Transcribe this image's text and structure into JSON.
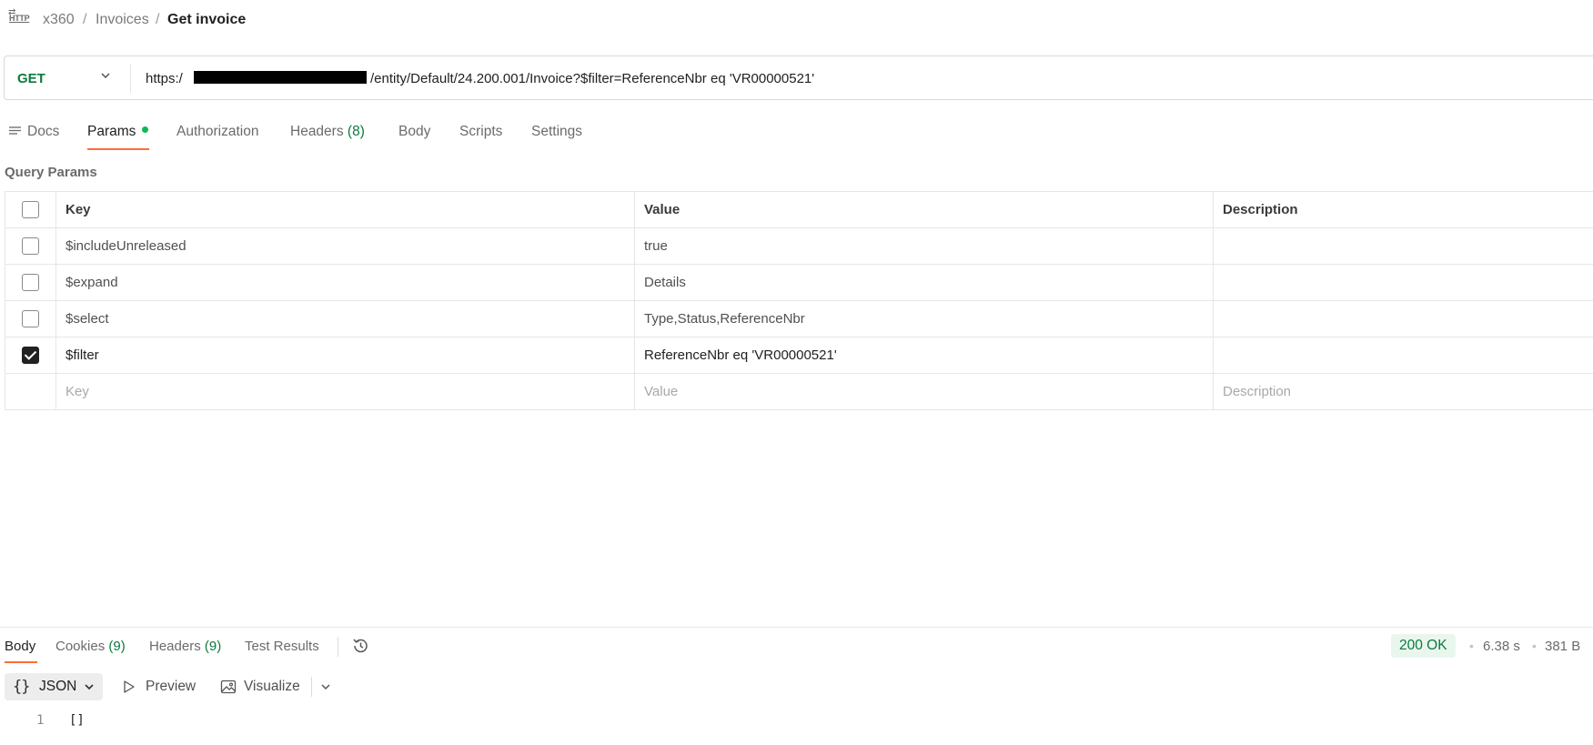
{
  "breadcrumb": {
    "icon_label": "HTTP",
    "items": [
      "x360",
      "Invoices",
      "Get invoice"
    ],
    "separator": "/"
  },
  "request": {
    "method": "GET",
    "url_prefix": "https:/",
    "url_suffix": "/entity/Default/24.200.001/Invoice?$filter=ReferenceNbr eq 'VR00000521'"
  },
  "request_tabs": {
    "docs": "Docs",
    "params": "Params",
    "authorization": "Authorization",
    "headers": "Headers",
    "headers_count": "(8)",
    "body": "Body",
    "scripts": "Scripts",
    "settings": "Settings"
  },
  "query_params": {
    "title": "Query Params",
    "columns": {
      "key": "Key",
      "value": "Value",
      "description": "Description"
    },
    "rows": [
      {
        "checked": false,
        "key": "$includeUnreleased",
        "value": "true",
        "description": ""
      },
      {
        "checked": false,
        "key": "$expand",
        "value": "Details",
        "description": ""
      },
      {
        "checked": false,
        "key": "$select",
        "value": "Type,Status,ReferenceNbr",
        "description": ""
      },
      {
        "checked": true,
        "key": "$filter",
        "value": "ReferenceNbr eq 'VR00000521'",
        "description": ""
      }
    ],
    "placeholder": {
      "key": "Key",
      "value": "Value",
      "description": "Description"
    }
  },
  "response": {
    "tabs": {
      "body": "Body",
      "cookies": "Cookies",
      "cookies_count": "(9)",
      "headers": "Headers",
      "headers_count": "(9)",
      "test_results": "Test Results"
    },
    "status": "200 OK",
    "time": "6.38 s",
    "size": "381 B",
    "format": "JSON",
    "preview": "Preview",
    "visualize": "Visualize",
    "line_number": "1",
    "content": "[]"
  },
  "colors": {
    "accent": "#ff6c37",
    "method_get": "#0b7a3e",
    "status_ok_bg": "#e9f6ee",
    "dot": "#0cbb52"
  }
}
